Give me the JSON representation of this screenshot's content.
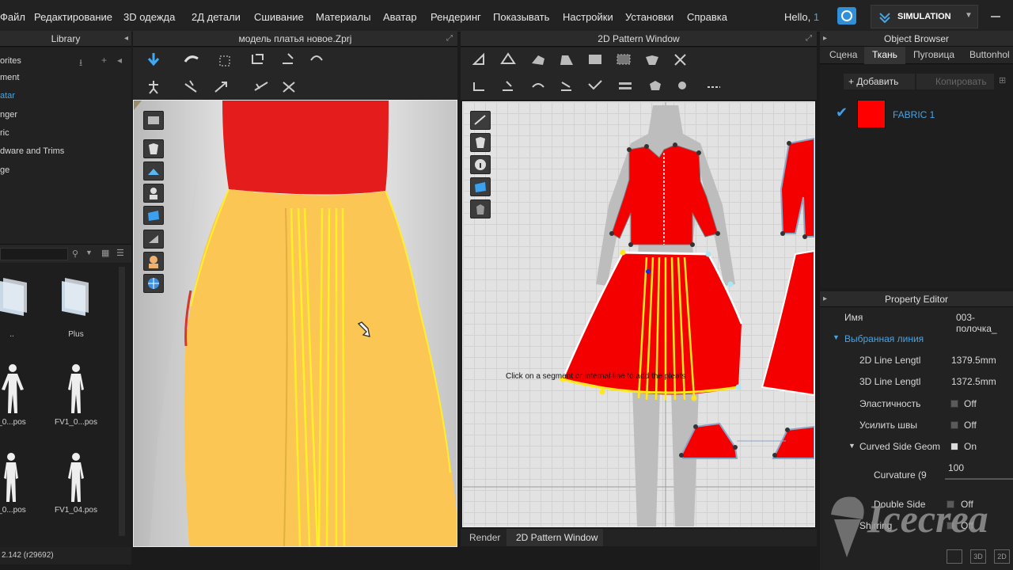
{
  "menu": [
    "Файл",
    "Редактирование",
    "3D одежда",
    "2Д детали",
    "Сшивание",
    "Материалы",
    "Аватар",
    "Рендеринг",
    "Показывать",
    "Настройки",
    "Установки",
    "Справка"
  ],
  "user": {
    "greeting": "Hello,",
    "number": "1"
  },
  "simulation_label": "SIMULATION",
  "library": {
    "title": "Library",
    "items": [
      "orites",
      "ment",
      "atar",
      "nger",
      "ric",
      "dware and Trims",
      "ge"
    ],
    "thumbs": [
      "..",
      "Plus",
      "_0...pos",
      "FV1_0...pos",
      "_0...pos",
      "FV1_04.pos"
    ]
  },
  "viewport3d": {
    "title": "модель платья новое.Zprj"
  },
  "pattern2d": {
    "title": "2D Pattern Window",
    "hint": "Click on a segment or internal line to add the pleats"
  },
  "bottom_tabs": [
    "Render",
    "2D Pattern Window"
  ],
  "status": "2.142 (r29692)",
  "object_browser": {
    "title": "Object Browser",
    "tabs": [
      "Сцена",
      "Ткань",
      "Пуговица",
      "Buttonhol"
    ],
    "add_label": "+ Добавить",
    "copy_label": "Копировать",
    "fabric_name": "FABRIC 1",
    "fabric_color": "#ff0000"
  },
  "property_editor": {
    "title": "Property Editor",
    "name_label": "Имя",
    "name_value": "003-полочка_",
    "section": "Выбранная линия",
    "rows": [
      {
        "label": "2D Line Lengtl",
        "value": "1379.5mm"
      },
      {
        "label": "3D Line Lengtl",
        "value": "1372.5mm"
      },
      {
        "label": "Эластичность",
        "value": "Off"
      },
      {
        "label": "Усилить швы",
        "value": "Off"
      },
      {
        "label": "Curved Side Geom",
        "value": "On"
      },
      {
        "label": "Curvature (9",
        "value": "100"
      },
      {
        "label": "Double Side",
        "value": "Off"
      },
      {
        "label": "Shirring",
        "value": "Off"
      }
    ]
  },
  "watermark": "Icecrea"
}
